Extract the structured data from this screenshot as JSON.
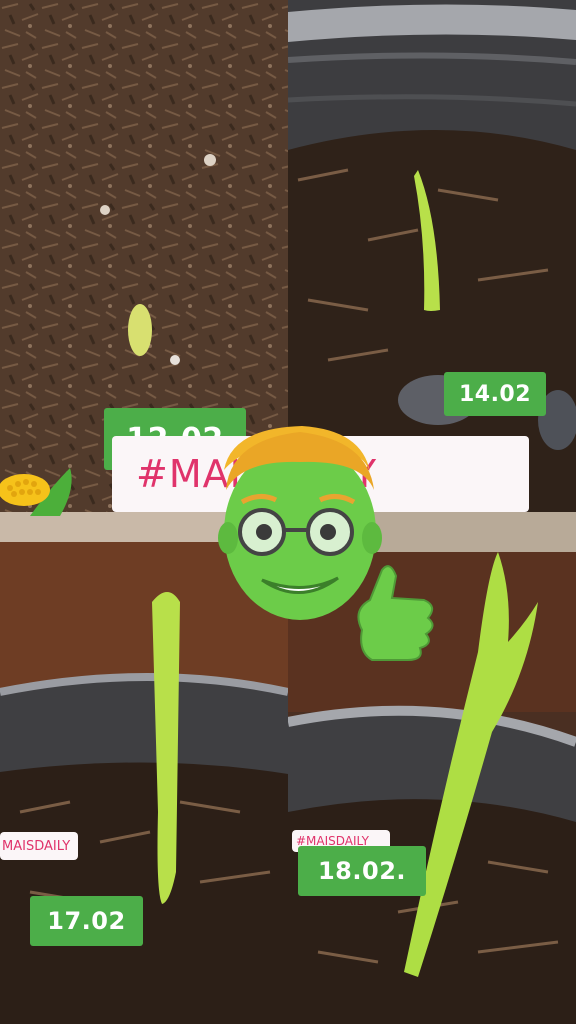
{
  "panels": [
    {
      "date": "12.02"
    },
    {
      "date": "14.02"
    },
    {
      "date": "17.02"
    },
    {
      "date": "18.02."
    }
  ],
  "hashtag": {
    "large": "#MAISDAILY",
    "small_left": "MAISDAILY",
    "small_right": "#MAISDAILY"
  },
  "colors": {
    "badge_green": "#4cae49",
    "hashtag_pink": "#e0336b",
    "sprout_green": "#b8e04a"
  },
  "stickers": [
    "corn-sticker",
    "memoji-thumbs-up"
  ]
}
